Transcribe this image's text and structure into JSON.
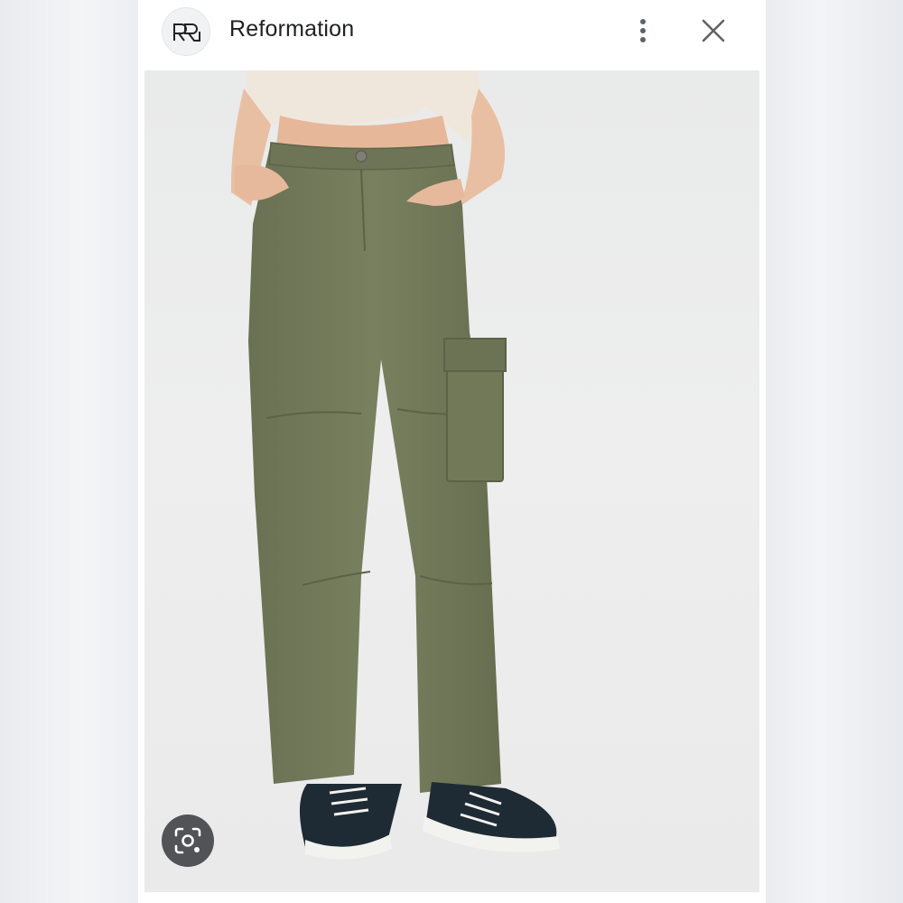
{
  "header": {
    "site_name": "Reformation",
    "logo_icon": "reformation-logo-icon",
    "more_icon": "more-vertical-icon",
    "close_icon": "close-icon"
  },
  "image": {
    "subject": "product-photo",
    "colors": {
      "pants": "#6f7658",
      "background": "#ececec",
      "top": "#efe6db",
      "shoe": "#1e2a33"
    }
  },
  "actions": {
    "lens_icon": "lens-search-icon"
  }
}
